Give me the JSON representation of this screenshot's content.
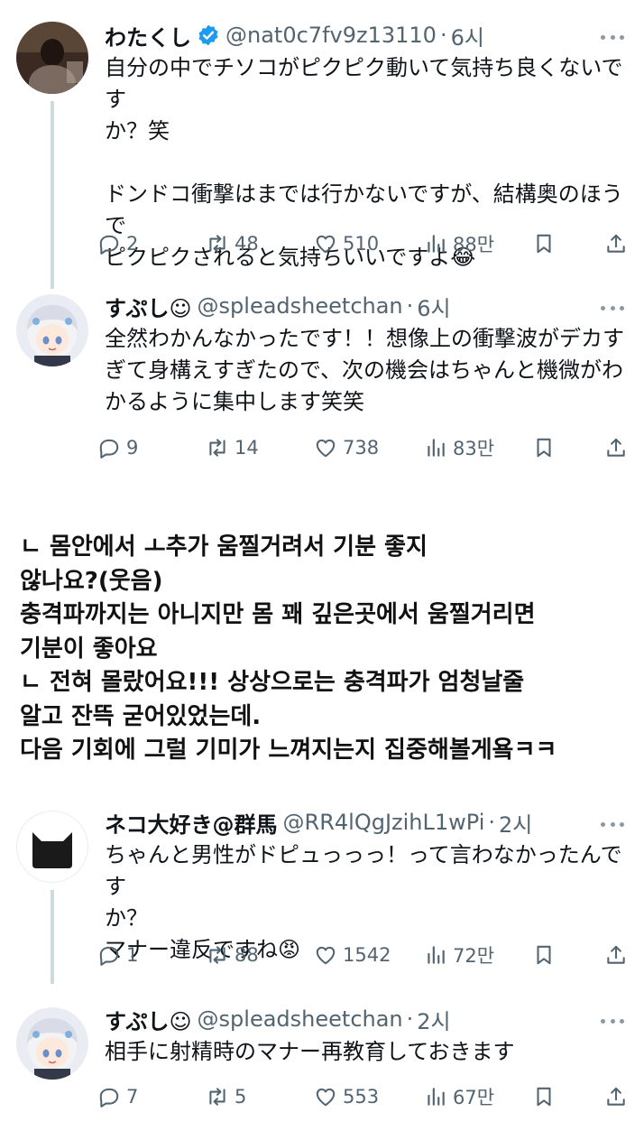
{
  "tweets": [
    {
      "name": "わたくし",
      "verified": true,
      "handle": "@nat0c7fv9z13110",
      "time": "6시",
      "lines": [
        "自分の中でチソコがピクピク動いて気持ち良くないです",
        "か？笑",
        "",
        "ドンドコ衝撃はまでは行かないですが、結構奥のほうで",
        "ピクピクされると気持ちいいですよ😂"
      ],
      "replies": "2",
      "retweets": "48",
      "likes": "510",
      "views": "88만"
    },
    {
      "name": "すぷし☺",
      "handle": "@spleadsheetchan",
      "time": "6시",
      "lines": [
        "全然わかんなかったです！！想像上の衝撃波がデカす",
        "ぎて身構えすぎたので、次の機会はちゃんと機微がわ",
        "かるように集中します笑笑"
      ],
      "replies": "9",
      "retweets": "14",
      "likes": "738",
      "views": "83만"
    },
    {
      "name": "ネコ大好き@群馬",
      "handle": "@RR4lQgJzihL1wPi",
      "time": "2시",
      "lines": [
        "ちゃんと男性がドピュっっっ！って言わなかったんです",
        "か？",
        "マナー違反ですね😡"
      ],
      "replies": "1",
      "retweets": "88",
      "likes": "1542",
      "views": "72만"
    },
    {
      "name": "すぷし☺",
      "handle": "@spleadsheetchan",
      "time": "2시",
      "lines": [
        "相手に射精時のマナー再教育しておきます"
      ],
      "replies": "7",
      "retweets": "5",
      "likes": "553",
      "views": "67만"
    }
  ],
  "translation": {
    "lines": [
      "ㄴ 몸안에서 ㅗ추가 움찔거려서 기분 좋지",
      "않나요?(웃음)",
      "충격파까지는 아니지만 몸 꽤 깊은곳에서 움찔거리면",
      "기분이 좋아요",
      "ㄴ 전혀 몰랐어요!!! 상상으로는 충격파가 엄청날줄",
      "알고 잔뜩 굳어있었는데.",
      "다음 기회에 그럴 기미가 느껴지는지 집중해볼게욬ㅋㅋ"
    ]
  },
  "colors": {
    "text": "#0f1419",
    "secondary": "#536471",
    "verified": "#1d9bf0",
    "thread_line": "#cfd9de"
  },
  "icons": [
    "reply-icon",
    "retweet-icon",
    "like-icon",
    "views-icon",
    "bookmark-icon",
    "share-icon",
    "more-icon",
    "verified-badge-icon"
  ]
}
